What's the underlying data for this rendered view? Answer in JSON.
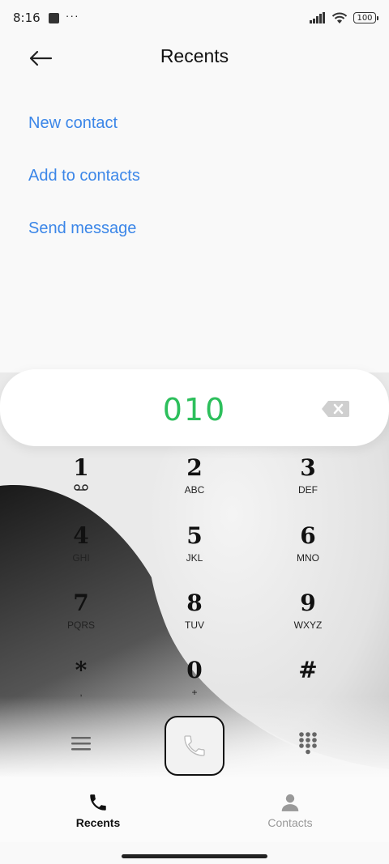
{
  "status_bar": {
    "time": "8:16",
    "dots": "···",
    "battery": "100"
  },
  "header": {
    "title": "Recents"
  },
  "actions": [
    "New contact",
    "Add to contacts",
    "Send message"
  ],
  "dial": {
    "number": "010"
  },
  "keypad": [
    {
      "digit": "1",
      "letters": ""
    },
    {
      "digit": "2",
      "letters": "ABC"
    },
    {
      "digit": "3",
      "letters": "DEF"
    },
    {
      "digit": "4",
      "letters": "GHI"
    },
    {
      "digit": "5",
      "letters": "JKL"
    },
    {
      "digit": "6",
      "letters": "MNO"
    },
    {
      "digit": "7",
      "letters": "PQRS"
    },
    {
      "digit": "8",
      "letters": "TUV"
    },
    {
      "digit": "9",
      "letters": "WXYZ"
    },
    {
      "digit": "*",
      "letters": ","
    },
    {
      "digit": "0",
      "letters": "+"
    },
    {
      "digit": "#",
      "letters": ""
    }
  ],
  "bottom_nav": {
    "recents": "Recents",
    "contacts": "Contacts"
  },
  "colors": {
    "link": "#3b86e8",
    "number": "#2dbf5c"
  }
}
